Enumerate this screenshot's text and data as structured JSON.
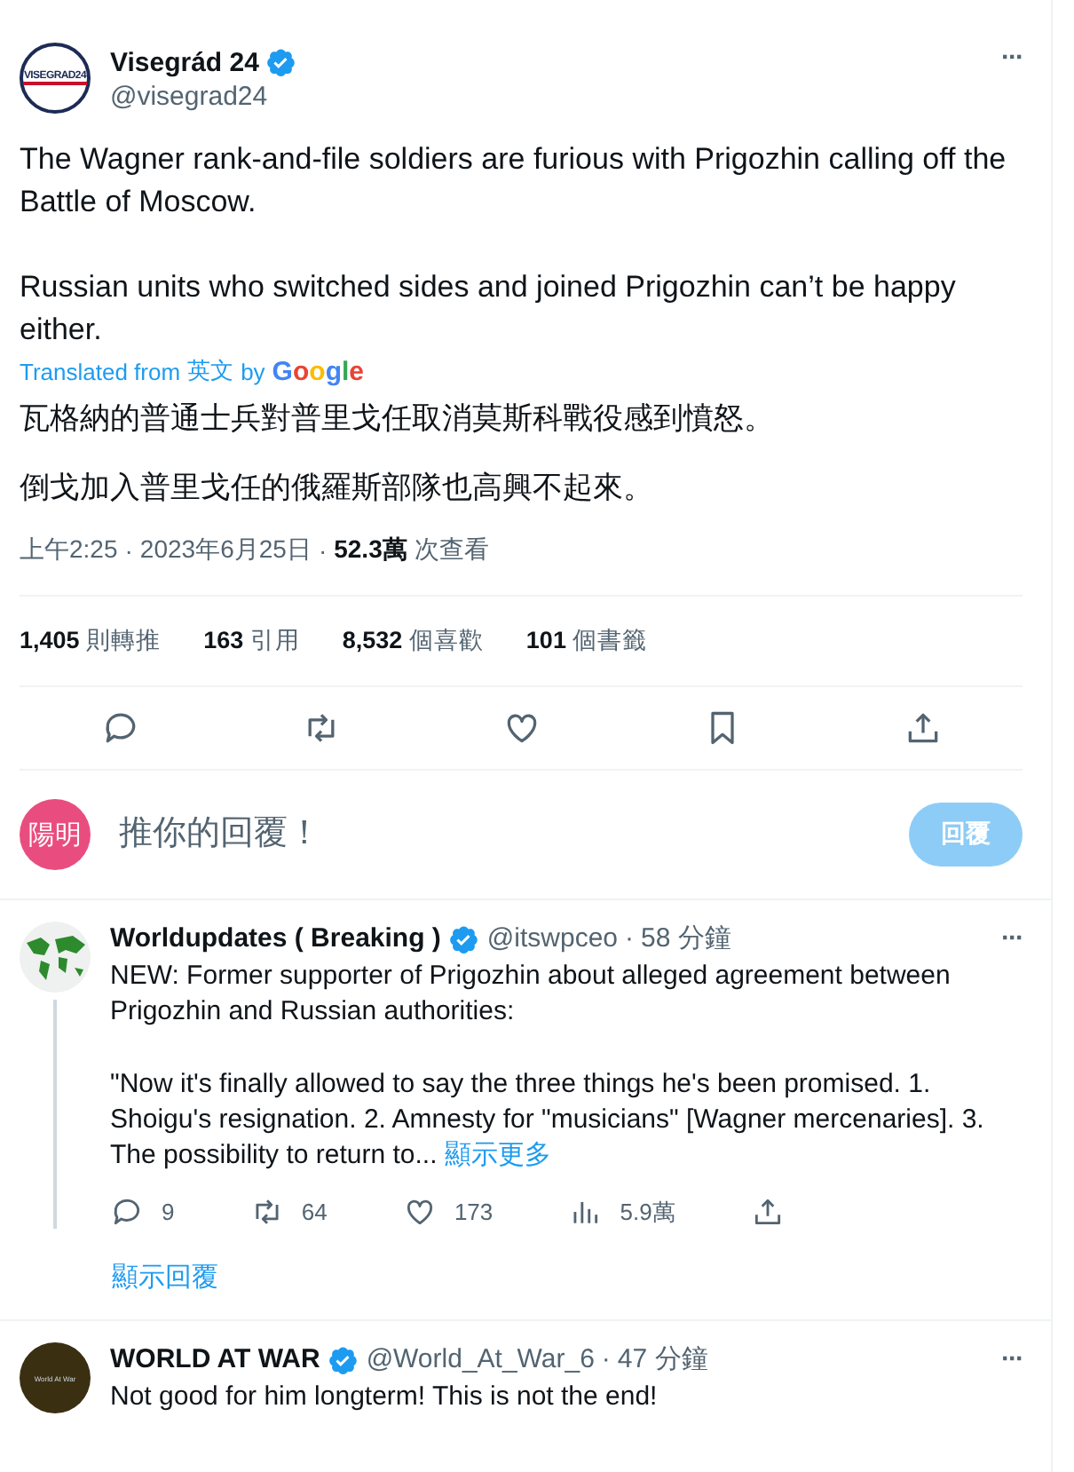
{
  "tweet": {
    "avatar_text": "VISEGRAD24",
    "name": "Visegrád 24",
    "verified": true,
    "handle": "@visegrad24",
    "more": "···",
    "paragraphs": [
      "The Wagner rank-and-file soldiers are furious with Prigozhin calling off the Battle of Moscow.",
      "Russian units who switched sides and joined Prigozhin can’t be happy either."
    ],
    "translated_from": "Translated from",
    "source_language": "英文",
    "by": "by",
    "translator": "Google",
    "translation": [
      "瓦格納的普通士兵對普里戈任取消莫斯科戰役感到憤怒。",
      "倒戈加入普里戈任的俄羅斯部隊也高興不起來。"
    ],
    "time": "上午2:25",
    "separator_1": "·",
    "date": "2023年6月25日",
    "separator_2": "·",
    "views": "52.3萬",
    "views_label": "次查看",
    "stats": [
      "**1,405** 則轉推",
      "**163** 引用",
      "**8,532** 個喜歡",
      "**101** 個書籤"
    ],
    "actions": [
      {
        "kind": "reply"
      },
      {
        "kind": "retweet"
      },
      {
        "kind": "like"
      },
      {
        "kind": "bookmark"
      },
      {
        "kind": "share"
      }
    ]
  },
  "composer": {
    "avatar_text": "陽明",
    "placeholder": "推你的回覆！",
    "button": "回覆",
    "disabled": true
  },
  "replies": [
    {
      "name": "Worldupdates ( Breaking )",
      "verified": true,
      "handle": "@itswpceo",
      "separator": "·",
      "time": "58 分鐘",
      "more": "···",
      "paragraphs": [
        "NEW: Former supporter of Prigozhin about alleged agreement between Prigozhin and Russian authorities:",
        "\"Now it's finally allowed to say the three things he's been promised. 1. Shoigu's resignation. 2. Amnesty for \"musicians\" [Wagner mercenaries]. 3. The possibility to return to..."
      ],
      "show_more": "顯示更多",
      "actions": [
        {
          "kind": "reply",
          "count": "9"
        },
        {
          "kind": "retweet",
          "count": "64"
        },
        {
          "kind": "like",
          "count": "173"
        },
        {
          "kind": "views",
          "count": "5.9萬"
        },
        {
          "kind": "share"
        }
      ],
      "show_replies": "顯示回覆",
      "thread": true
    },
    {
      "avatar_text": "World At War",
      "name": "WORLD AT WAR",
      "verified": true,
      "handle": "@World_At_War_6",
      "separator": "·",
      "time": "47 分鐘",
      "more": "···",
      "paragraphs": [
        "Not good for him longterm! This is not the end!"
      ],
      "thread": false
    }
  ]
}
